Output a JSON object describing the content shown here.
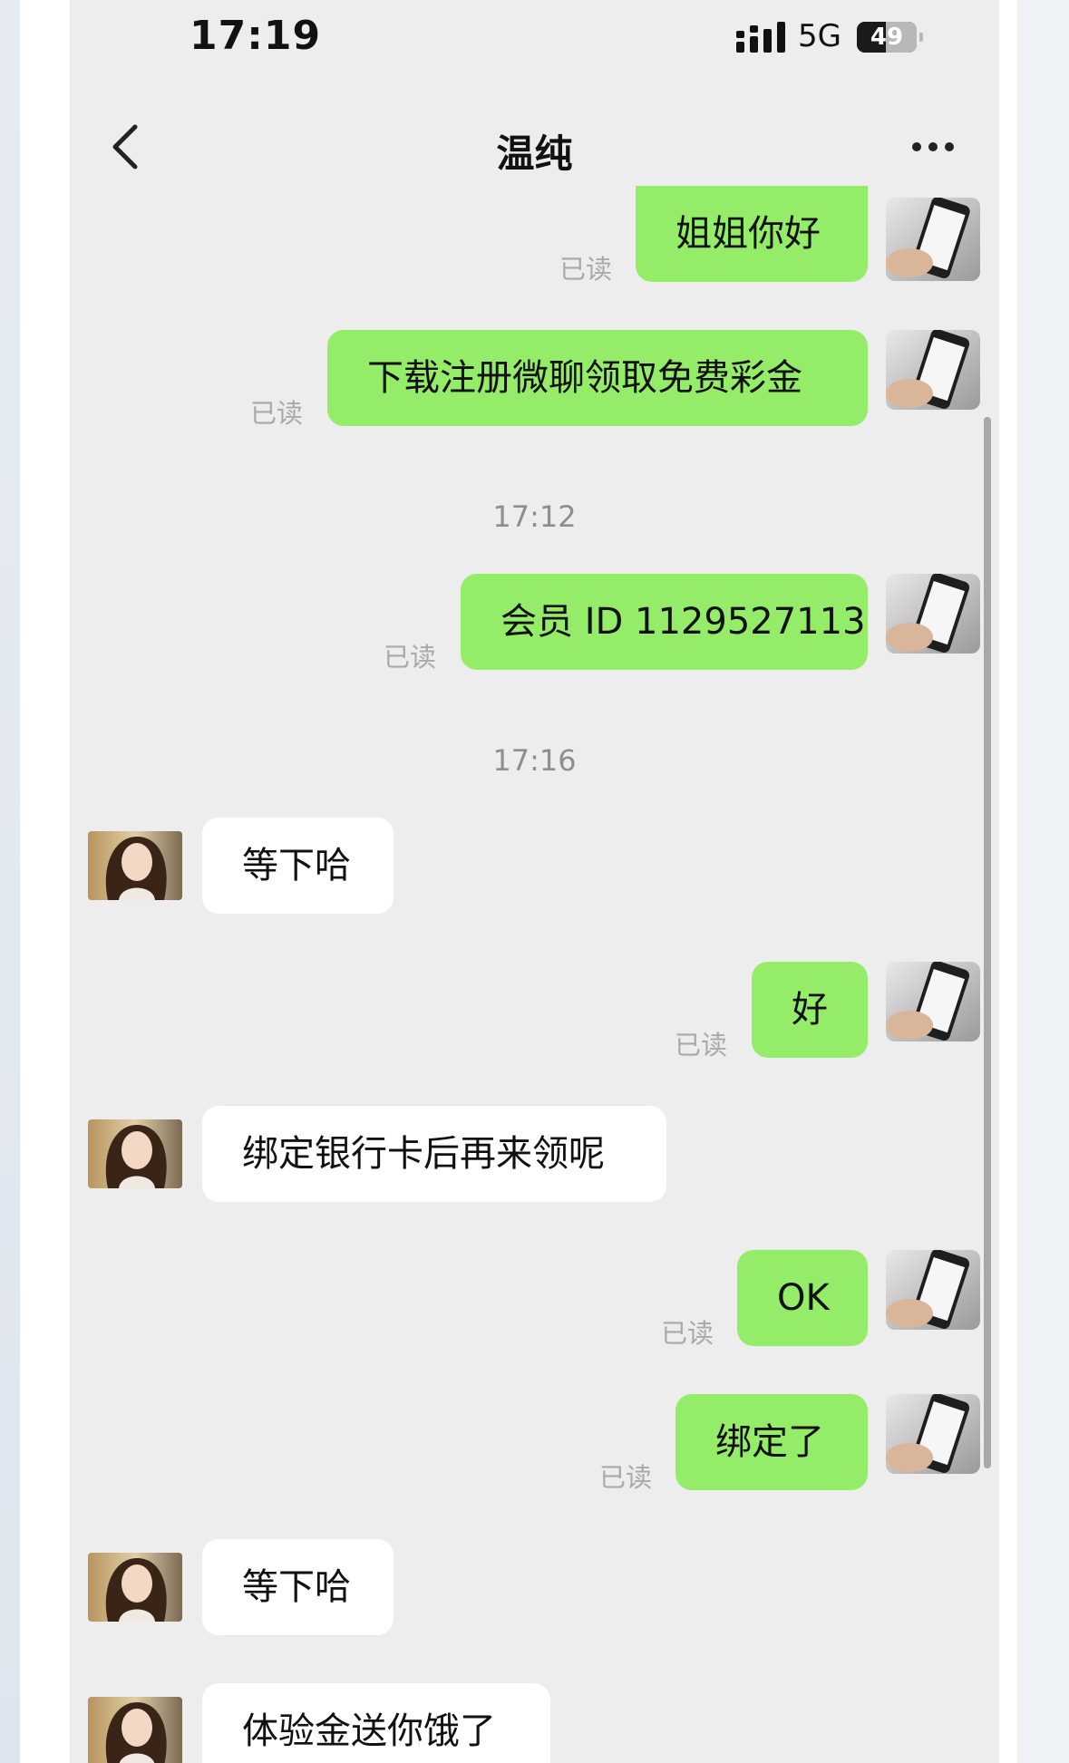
{
  "status_bar": {
    "time": "17:19",
    "network": "5G",
    "battery": "49",
    "battery_level": 0.49
  },
  "header": {
    "title": "温纯",
    "back_icon": "chevron-left-icon",
    "more_icon": "ellipsis-icon"
  },
  "messages": [
    {
      "from": "me",
      "text": "姐姐你好",
      "status": "已读"
    },
    {
      "from": "me",
      "text": "下载注册微聊领取免费彩金",
      "status": "已读"
    },
    {
      "type": "timestamp",
      "text": "17:12"
    },
    {
      "from": "me",
      "text": "会员 ID 1129527113",
      "status": "已读"
    },
    {
      "type": "timestamp",
      "text": "17:16"
    },
    {
      "from": "her",
      "text": "等下哈"
    },
    {
      "from": "me",
      "text": "好",
      "status": "已读"
    },
    {
      "from": "her",
      "text": "绑定银行卡后再来领呢"
    },
    {
      "from": "me",
      "text": "OK",
      "status": "已读"
    },
    {
      "from": "me",
      "text": "绑定了",
      "status": "已读"
    },
    {
      "from": "her",
      "text": "等下哈"
    },
    {
      "from": "her",
      "text": "体验金送你饿了"
    }
  ],
  "colors": {
    "my_bubble": "#95ec69",
    "her_bubble": "#ffffff",
    "chat_background": "#ededed",
    "read_status": "#a9a9a9"
  }
}
